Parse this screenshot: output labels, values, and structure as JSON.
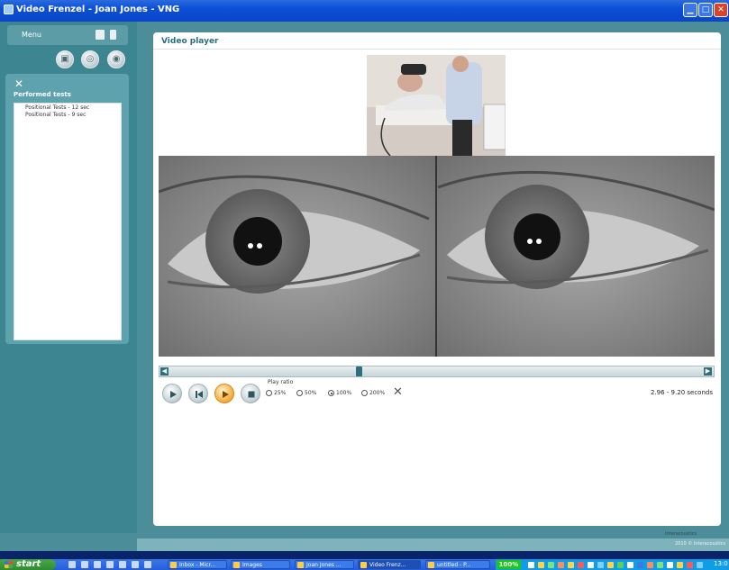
{
  "window": {
    "title": "Video Frenzel - Joan Jones - VNG",
    "buttons": [
      "minimize",
      "maximize",
      "close"
    ]
  },
  "sidebar": {
    "menu_label": "Menu",
    "icons": [
      "save-icon",
      "document-icon"
    ],
    "toolbar": [
      "video-camera-icon",
      "headphones-icon",
      "eye-icon"
    ],
    "panel": {
      "heading": "Performed tests",
      "items": [
        {
          "label": "Positional Tests - 12 sec"
        },
        {
          "label": "Positional Tests - 9 sec"
        }
      ]
    }
  },
  "player": {
    "title": "Video player",
    "controls": [
      "play",
      "step-back",
      "play-slow",
      "stop"
    ],
    "rate_label": "Play ratio",
    "rates": [
      {
        "label": "25%",
        "selected": false
      },
      {
        "label": "50%",
        "selected": false
      },
      {
        "label": "100%",
        "selected": true
      },
      {
        "label": "200%",
        "selected": false
      }
    ],
    "time": "2.96 - 9.20 seconds",
    "timeline_position": 0.35
  },
  "footer": {
    "note": "Interacoustics",
    "strip": "2010 © Interacoustics"
  },
  "taskbar": {
    "start": "start",
    "tasks": [
      {
        "label": "Inbox - Micr..."
      },
      {
        "label": "Images"
      },
      {
        "label": "Joan Jones ..."
      },
      {
        "label": "Video Frenz..."
      },
      {
        "label": "untitled - P..."
      }
    ],
    "zoom": "100%",
    "clock": "13:0"
  },
  "colors": {
    "sidebar": "#3e8592",
    "panel": "#5ea2ad",
    "accent": "#2c6e84",
    "active_button": "#f4b24a"
  }
}
